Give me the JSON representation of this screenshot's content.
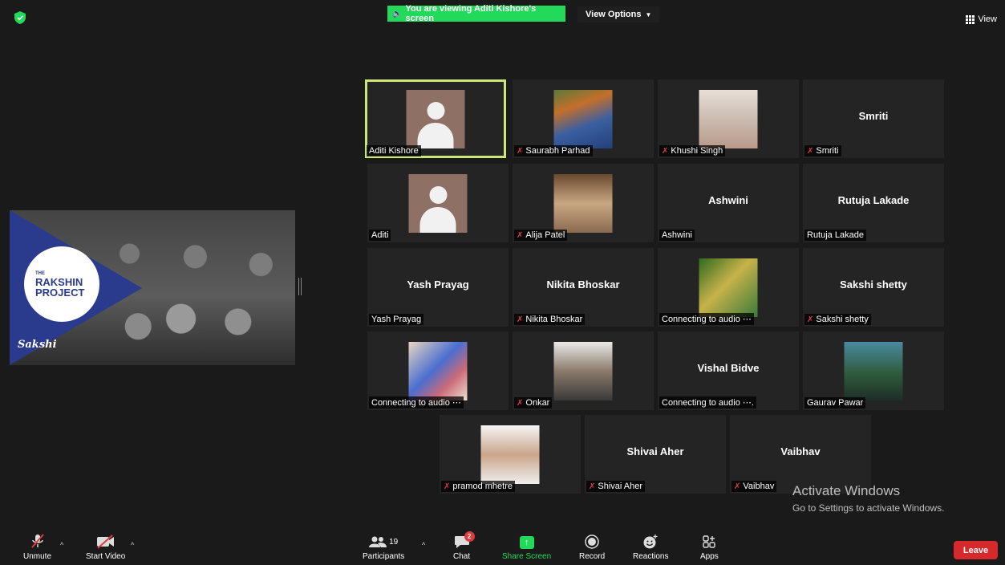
{
  "banner": {
    "text": "You are viewing Aditi Kishore's screen",
    "color": "#23d959"
  },
  "view_options": {
    "label": "View Options"
  },
  "view": {
    "label": "View"
  },
  "shared_screen": {
    "logo_line1": "THE",
    "logo_line2": "RAKSHIN",
    "logo_line3": "PROJECT",
    "sakshi": "Sakshi"
  },
  "tiles": [
    {
      "name": "Aditi Kishore",
      "big": "",
      "muted": false
    },
    {
      "name": "Saurabh Parhad",
      "big": "",
      "muted": true
    },
    {
      "name": "Khushi Singh",
      "big": "",
      "muted": true
    },
    {
      "name": "Smriti",
      "big": "Smriti",
      "muted": true
    },
    {
      "name": "Aditi",
      "big": "",
      "muted": false
    },
    {
      "name": "Alija Patel",
      "big": "",
      "muted": true
    },
    {
      "name": "Ashwini",
      "big": "Ashwini",
      "muted": false
    },
    {
      "name": "Rutuja Lakade",
      "big": "Rutuja Lakade",
      "muted": false
    },
    {
      "name": "Yash Prayag",
      "big": "Yash Prayag",
      "muted": false
    },
    {
      "name": "Nikita Bhoskar",
      "big": "Nikita Bhoskar",
      "muted": true
    },
    {
      "name": "Connecting to audio ⋯",
      "big": "",
      "muted": false
    },
    {
      "name": "Sakshi  shetty",
      "big": "Sakshi  shetty",
      "muted": true
    },
    {
      "name": "Connecting to audio ⋯",
      "big": "",
      "muted": false
    },
    {
      "name": "Onkar",
      "big": "",
      "muted": true
    },
    {
      "name": "Connecting to audio ⋯.",
      "big": "Vishal Bidve",
      "muted": false
    },
    {
      "name": "Gaurav Pawar",
      "big": "",
      "muted": false
    },
    {
      "name": "pramod mhetre",
      "big": "",
      "muted": true
    },
    {
      "name": "Shivai Aher",
      "big": "Shivai Aher",
      "muted": true
    },
    {
      "name": "Vaibhav",
      "big": "Vaibhav",
      "muted": true
    }
  ],
  "watermark": {
    "line1": "Activate Windows",
    "line2": "Go to Settings to activate Windows."
  },
  "toolbar": {
    "unmute": "Unmute",
    "start_video": "Start Video",
    "participants": "Participants",
    "participants_count": "19",
    "chat": "Chat",
    "chat_badge": "2",
    "share_screen": "Share Screen",
    "record": "Record",
    "reactions": "Reactions",
    "apps": "Apps",
    "leave": "Leave"
  }
}
